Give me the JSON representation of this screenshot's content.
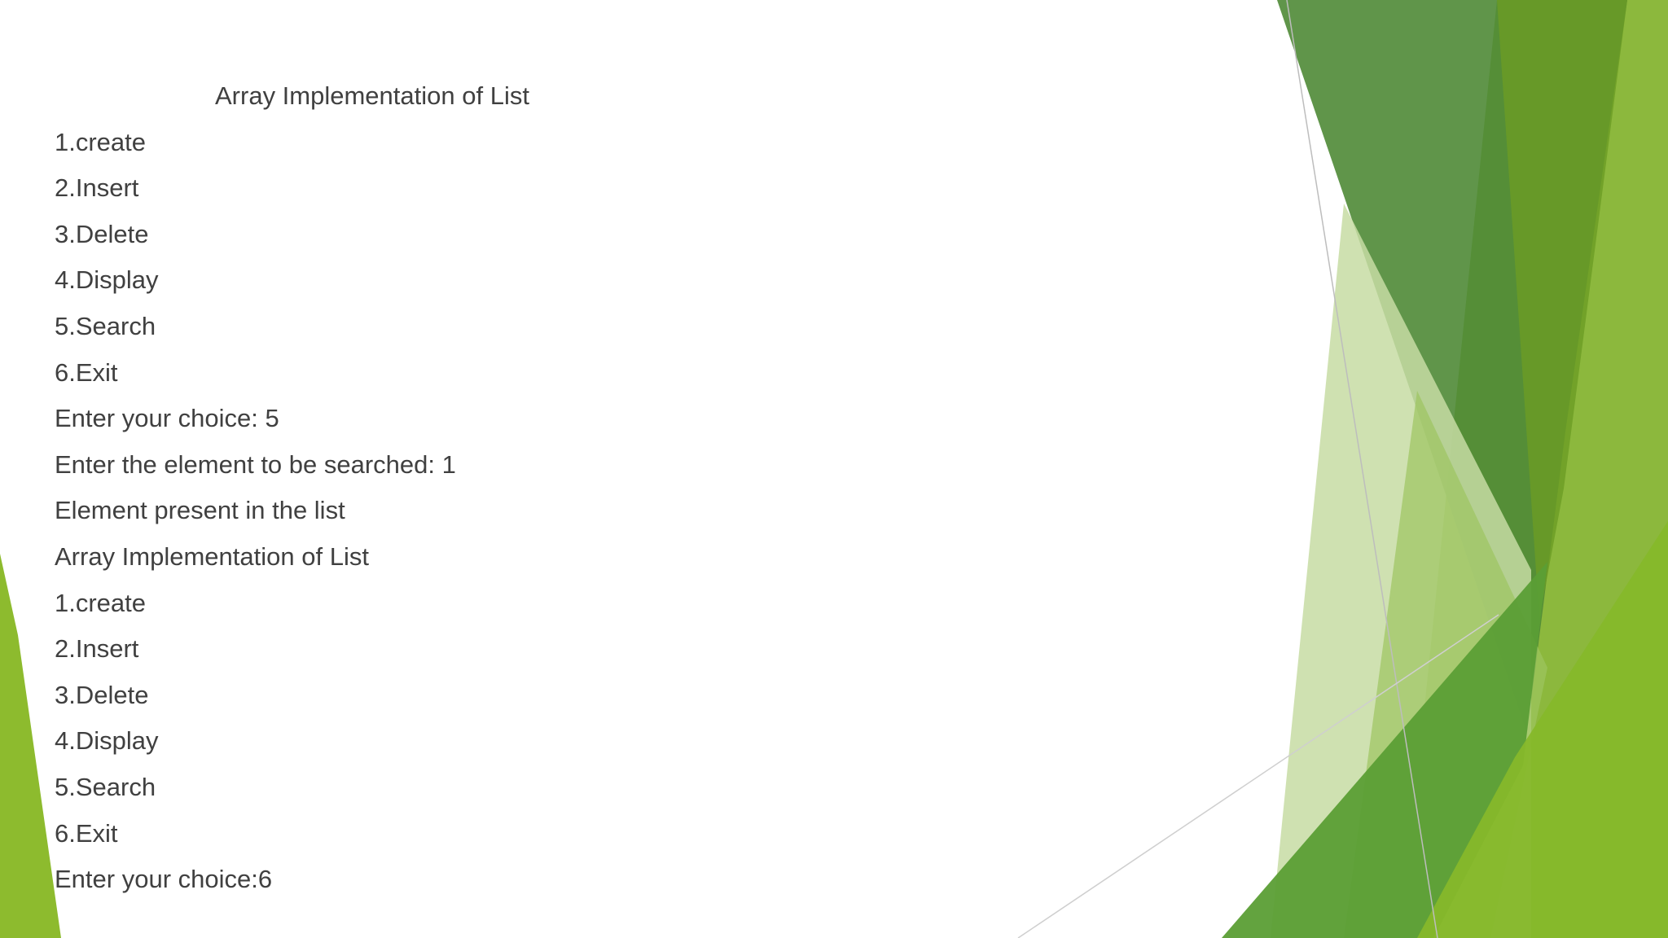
{
  "slide": {
    "lines": [
      "Array Implementation of List",
      "1.create",
      "2.Insert",
      "3.Delete",
      "4.Display",
      "5.Search",
      "6.Exit",
      "Enter your choice: 5",
      "Enter the element to be searched: 1",
      "Element present in the list",
      "Array Implementation of List",
      "1.create",
      "2.Insert",
      "3.Delete",
      "4.Display",
      "5.Search",
      "6.Exit",
      "Enter your choice:6"
    ]
  },
  "theme": {
    "text_color": "#404040",
    "accent_dark": "#4e8a34",
    "accent_mid": "#6aa628",
    "accent_light": "#8dbb2e",
    "accent_pale": "#c9dca8"
  }
}
